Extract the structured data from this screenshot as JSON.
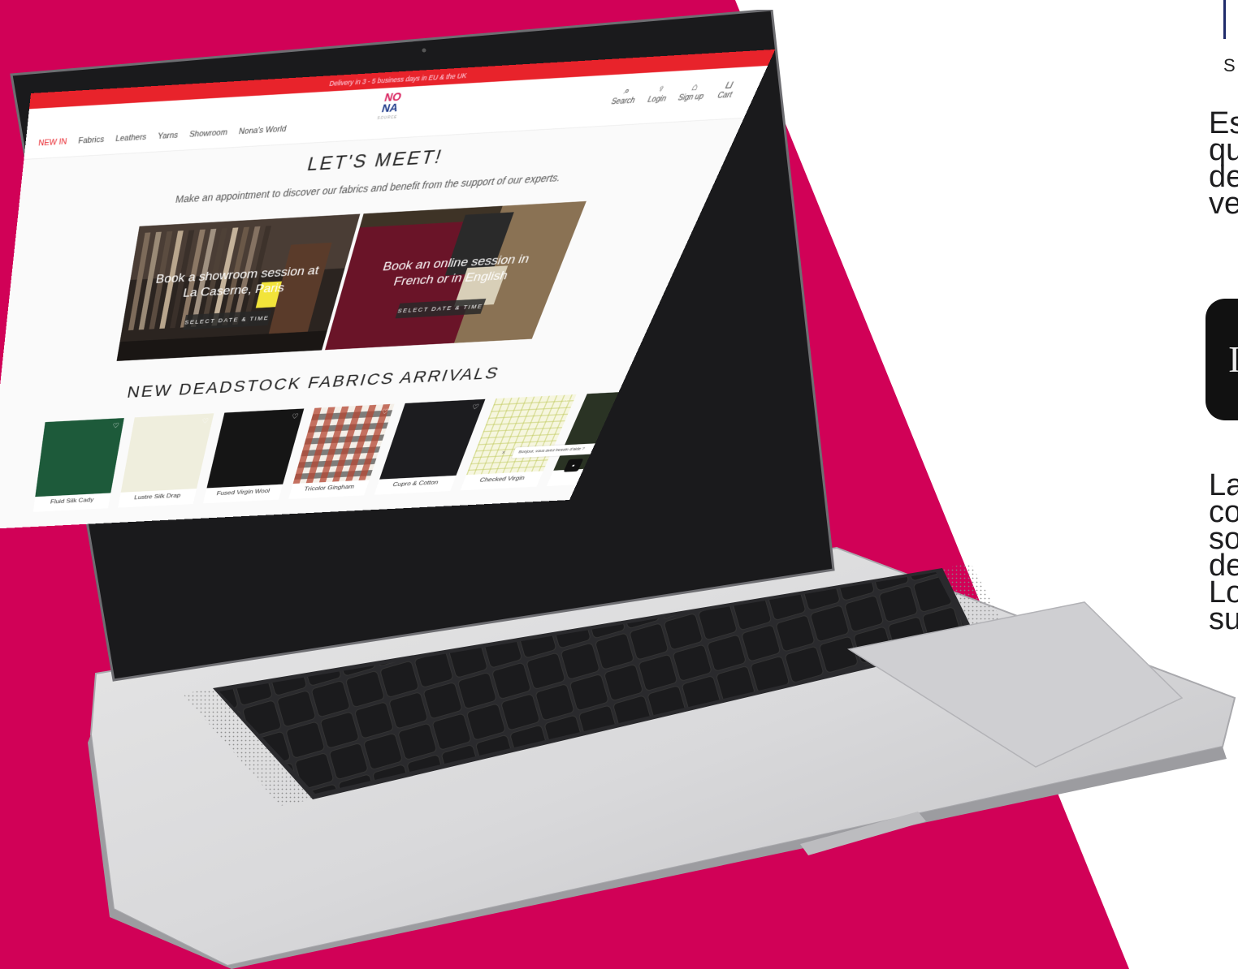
{
  "announcement": "Delivery in 3 - 5 business days in EU & the UK",
  "brand": {
    "line1": "NO",
    "line2": "NA",
    "sub": "SOURCE"
  },
  "nav": [
    "NEW IN",
    "Fabrics",
    "Leathers",
    "Yarns",
    "Showroom",
    "Nona's World"
  ],
  "tools": [
    {
      "icon": "⌕",
      "label": "Search"
    },
    {
      "icon": "♀",
      "label": "Login"
    },
    {
      "icon": "⌂",
      "label": "Sign up"
    },
    {
      "icon": "⊔",
      "label": "Cart"
    }
  ],
  "meet": {
    "title": "LET'S MEET!",
    "subtitle": "Make an appointment to discover our fabrics and benefit from the support of our experts."
  },
  "cards": [
    {
      "text": "Book a showroom session at La Caserne, Paris",
      "button": "SELECT DATE & TIME"
    },
    {
      "text": "Book an online session in French or in English",
      "button": "SELECT DATE & TIME"
    }
  ],
  "arrivals_title": "NEW DEADSTOCK FABRICS ARRIVALS",
  "products": [
    {
      "name": "Fluid Silk Cady",
      "color": "#1d5a3a"
    },
    {
      "name": "Lustre Silk Drap",
      "color": "#efeedd"
    },
    {
      "name": "Fused Virgin Wool",
      "color": "#151515"
    },
    {
      "name": "Tricolor Gingham",
      "color": "#b9543b"
    },
    {
      "name": "Cupro & Cotton",
      "color": "#1c1c1f"
    },
    {
      "name": "Checked Virgin",
      "color": "#e8ebb8"
    }
  ],
  "chat": {
    "text": "Bonjour, vous avez besoin d'aide ?"
  },
  "right_text": {
    "logo_letter": "S",
    "para1": [
      "Es",
      "qu",
      "de",
      "ve"
    ],
    "para2": [
      "La",
      "co",
      "so",
      "de",
      "Lo",
      "su"
    ],
    "box_glyph": "I"
  },
  "colors": {
    "magenta": "#d10157",
    "red": "#e8232b"
  }
}
